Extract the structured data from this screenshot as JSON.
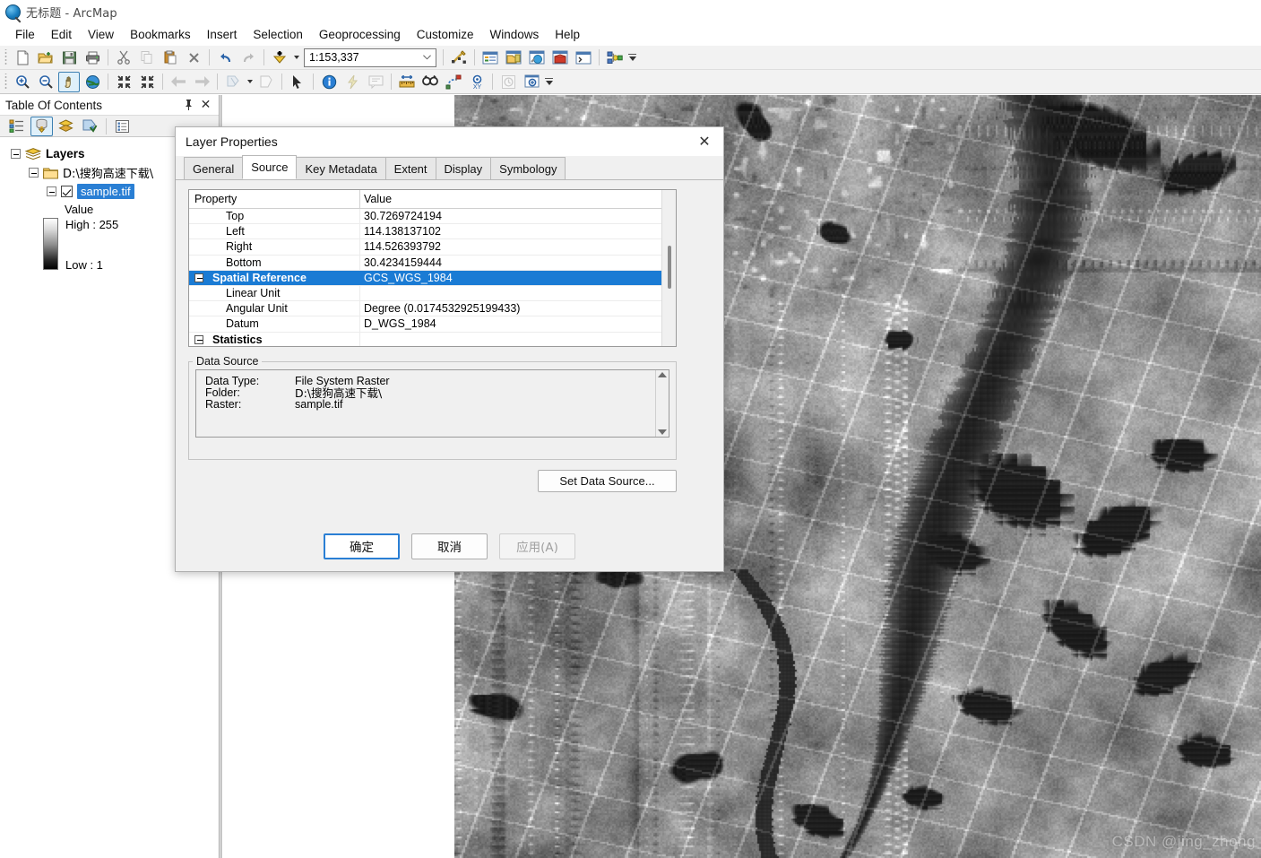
{
  "window": {
    "title": "无标题 - ArcMap",
    "app_icon": "arcmap-globe-icon"
  },
  "menu": {
    "items": [
      {
        "label": "File"
      },
      {
        "label": "Edit"
      },
      {
        "label": "View"
      },
      {
        "label": "Bookmarks"
      },
      {
        "label": "Insert"
      },
      {
        "label": "Selection"
      },
      {
        "label": "Geoprocessing"
      },
      {
        "label": "Customize"
      },
      {
        "label": "Windows"
      },
      {
        "label": "Help"
      }
    ]
  },
  "toolbar_standard": {
    "scale": {
      "value": "1:153,337",
      "placeholder": "1:153,337"
    },
    "buttons": [
      {
        "name": "new-map-icon",
        "title": "New Map File"
      },
      {
        "name": "open-icon",
        "title": "Open"
      },
      {
        "name": "save-icon",
        "title": "Save"
      },
      {
        "name": "print-icon",
        "title": "Print"
      },
      {
        "name": "cut-icon",
        "title": "Cut"
      },
      {
        "name": "copy-icon",
        "title": "Copy"
      },
      {
        "name": "paste-icon",
        "title": "Paste"
      },
      {
        "name": "delete-icon",
        "title": "Delete"
      },
      {
        "name": "undo-icon",
        "title": "Undo"
      },
      {
        "name": "redo-icon",
        "title": "Redo"
      },
      {
        "name": "add-data-icon",
        "title": "Add Data"
      },
      {
        "name": "editor-toolbar-icon",
        "title": "Editor Toolbar"
      },
      {
        "name": "table-of-contents-icon",
        "title": "Table Of Contents"
      },
      {
        "name": "catalog-icon",
        "title": "Catalog"
      },
      {
        "name": "search-window-icon",
        "title": "Search"
      },
      {
        "name": "arctoolbox-icon",
        "title": "ArcToolbox"
      },
      {
        "name": "python-window-icon",
        "title": "Python Window"
      },
      {
        "name": "model-builder-icon",
        "title": "ModelBuilder"
      }
    ]
  },
  "toolbar_tools": {
    "buttons": [
      {
        "name": "zoom-in-icon",
        "title": "Zoom In"
      },
      {
        "name": "zoom-out-icon",
        "title": "Zoom Out"
      },
      {
        "name": "pan-icon",
        "title": "Pan",
        "active": true
      },
      {
        "name": "full-extent-icon",
        "title": "Full Extent"
      },
      {
        "name": "fixed-zoom-in-icon",
        "title": "Fixed Zoom In"
      },
      {
        "name": "fixed-zoom-out-icon",
        "title": "Fixed Zoom Out"
      },
      {
        "name": "go-back-icon",
        "title": "Go Back To Previous Extent"
      },
      {
        "name": "go-forward-icon",
        "title": "Go To Next Extent"
      },
      {
        "name": "select-features-icon",
        "title": "Select Features"
      },
      {
        "name": "clear-selection-icon",
        "title": "Clear Selected Features"
      },
      {
        "name": "select-elements-icon",
        "title": "Select Elements"
      },
      {
        "name": "identify-icon",
        "title": "Identify"
      },
      {
        "name": "hyperlink-icon",
        "title": "Hyperlink"
      },
      {
        "name": "html-popup-icon",
        "title": "HTML Popup"
      },
      {
        "name": "measure-icon",
        "title": "Measure"
      },
      {
        "name": "find-icon",
        "title": "Find"
      },
      {
        "name": "find-route-icon",
        "title": "Find Route"
      },
      {
        "name": "go-to-xy-icon",
        "title": "Go To XY"
      },
      {
        "name": "time-slider-icon",
        "title": "Time Slider"
      },
      {
        "name": "create-viewer-icon",
        "title": "Create Viewer Window"
      }
    ]
  },
  "toc": {
    "title": "Table Of Contents",
    "pin_icon": "pin-icon",
    "close_icon": "close-icon",
    "toolbar": [
      {
        "name": "list-by-drawing-order-icon",
        "active": false
      },
      {
        "name": "list-by-source-icon",
        "active": true
      },
      {
        "name": "list-by-visibility-icon",
        "active": false
      },
      {
        "name": "list-by-selection-icon",
        "active": false
      },
      {
        "name": "options-icon",
        "active": false
      }
    ],
    "tree": {
      "root": "Layers",
      "folder": "D:\\搜狗高速下载\\",
      "layer": "sample.tif",
      "legend": {
        "value_label": "Value",
        "high_label": "High : 255",
        "low_label": "Low : 1"
      }
    }
  },
  "dialog": {
    "title": "Layer Properties",
    "close_icon": "close-icon",
    "tabs": [
      {
        "label": "General",
        "active": false
      },
      {
        "label": "Source",
        "active": true
      },
      {
        "label": "Key Metadata",
        "active": false
      },
      {
        "label": "Extent",
        "active": false
      },
      {
        "label": "Display",
        "active": false
      },
      {
        "label": "Symbology",
        "active": false
      }
    ],
    "property_grid": {
      "headers": [
        "Property",
        "Value"
      ],
      "rows": [
        {
          "property": "Top",
          "value": "30.7269724194",
          "kind": "child",
          "selected": false
        },
        {
          "property": "Left",
          "value": "114.138137102",
          "kind": "child",
          "selected": false
        },
        {
          "property": "Right",
          "value": "114.526393792",
          "kind": "child",
          "selected": false
        },
        {
          "property": "Bottom",
          "value": "30.4234159444",
          "kind": "child",
          "selected": false
        },
        {
          "property": "Spatial Reference",
          "value": "GCS_WGS_1984",
          "kind": "group",
          "selected": true
        },
        {
          "property": "Linear Unit",
          "value": "",
          "kind": "child",
          "selected": false
        },
        {
          "property": "Angular Unit",
          "value": "Degree (0.0174532925199433)",
          "kind": "child",
          "selected": false
        },
        {
          "property": "Datum",
          "value": "D_WGS_1984",
          "kind": "child",
          "selected": false
        },
        {
          "property": "Statistics",
          "value": "",
          "kind": "group",
          "selected": false
        }
      ]
    },
    "data_source": {
      "legend": "Data Source",
      "rows": [
        {
          "key": "Data Type:",
          "value": "File System Raster"
        },
        {
          "key": "Folder:",
          "value": "D:\\搜狗高速下载\\"
        },
        {
          "key": "Raster:",
          "value": "sample.tif"
        }
      ],
      "set_button": "Set Data Source..."
    },
    "footer": {
      "ok": "确定",
      "cancel": "取消",
      "apply": "应用(A)",
      "apply_disabled": true
    }
  },
  "map": {
    "watermark": "CSDN @jing_zhong"
  },
  "colors": {
    "selection_blue": "#1a7bd4",
    "toc_selection": "#2a7fd4",
    "accent_button": "#2a7fd4",
    "toolbar_bg": "#f2f2f2",
    "dialog_bg": "#f0f0f0"
  }
}
